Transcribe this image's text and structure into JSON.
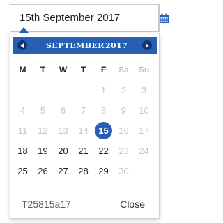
{
  "date_input": {
    "value": "15th September 2017",
    "icon": "calendar-icon"
  },
  "picker": {
    "month": "SEPTEMBER",
    "year": "2017",
    "nav": {
      "prev_icon": "chevron-left-icon",
      "next_icon": "chevron-right-icon"
    },
    "accent_color": "#2760b3",
    "weekdays": [
      {
        "label": "M",
        "weekend": false
      },
      {
        "label": "T",
        "weekend": false
      },
      {
        "label": "W",
        "weekend": false
      },
      {
        "label": "T",
        "weekend": false
      },
      {
        "label": "F",
        "weekend": false
      },
      {
        "label": "Sa",
        "weekend": true
      },
      {
        "label": "Su",
        "weekend": true
      }
    ],
    "weeks": [
      [
        {
          "d": "",
          "m": true
        },
        {
          "d": "",
          "m": true
        },
        {
          "d": "",
          "m": true
        },
        {
          "d": "",
          "m": true
        },
        {
          "d": "1",
          "m": true
        },
        {
          "d": "2",
          "m": true
        },
        {
          "d": "3",
          "m": true
        }
      ],
      [
        {
          "d": "4",
          "m": true
        },
        {
          "d": "5",
          "m": true
        },
        {
          "d": "6",
          "m": true
        },
        {
          "d": "7",
          "m": true
        },
        {
          "d": "8",
          "m": true
        },
        {
          "d": "9",
          "m": true
        },
        {
          "d": "10",
          "m": true
        }
      ],
      [
        {
          "d": "11",
          "m": true
        },
        {
          "d": "12",
          "m": true
        },
        {
          "d": "13",
          "m": true
        },
        {
          "d": "14",
          "m": true
        },
        {
          "d": "15",
          "m": false,
          "selected": true
        },
        {
          "d": "16",
          "m": true
        },
        {
          "d": "17",
          "m": true
        }
      ],
      [
        {
          "d": "18",
          "m": false
        },
        {
          "d": "19",
          "m": false
        },
        {
          "d": "20",
          "m": false
        },
        {
          "d": "21",
          "m": false
        },
        {
          "d": "22",
          "m": false
        },
        {
          "d": "23",
          "m": true
        },
        {
          "d": "24",
          "m": true
        }
      ],
      [
        {
          "d": "25",
          "m": false
        },
        {
          "d": "26",
          "m": false
        },
        {
          "d": "27",
          "m": false
        },
        {
          "d": "28",
          "m": false
        },
        {
          "d": "29",
          "m": false
        },
        {
          "d": "30",
          "m": true
        },
        {
          "d": "",
          "m": true
        }
      ]
    ],
    "footer": {
      "code": "T25815a17",
      "close_label": "Close"
    }
  }
}
